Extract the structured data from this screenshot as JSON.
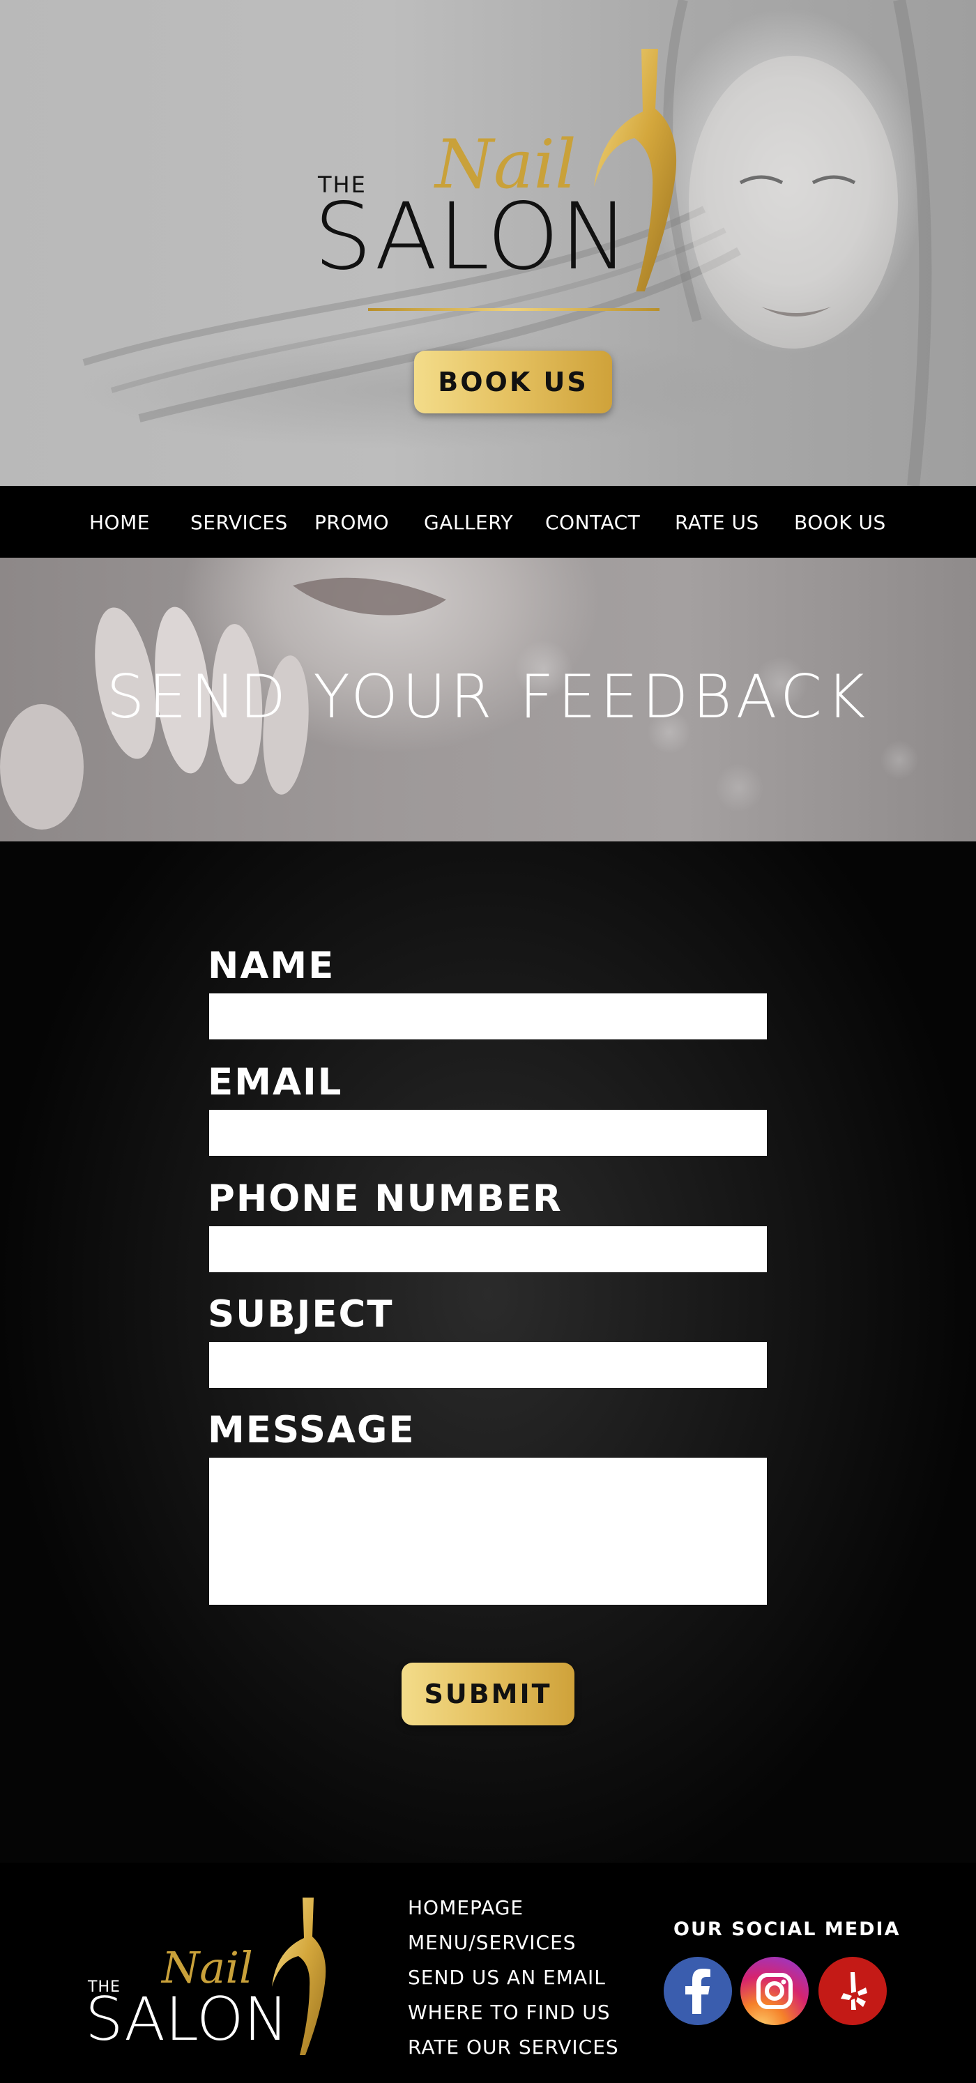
{
  "hero": {
    "logo": {
      "the": "THE",
      "nail": "Nail",
      "salon": "SALON"
    },
    "book_button": "BOOK US"
  },
  "nav": {
    "items": [
      {
        "label": "HOME"
      },
      {
        "label": "SERVICES"
      },
      {
        "label": "PROMO"
      },
      {
        "label": "GALLERY"
      },
      {
        "label": "CONTACT"
      },
      {
        "label": "RATE US"
      },
      {
        "label": "BOOK US"
      }
    ]
  },
  "banner": {
    "title": "SEND YOUR FEEDBACK"
  },
  "form": {
    "fields": [
      {
        "label": "NAME",
        "value": ""
      },
      {
        "label": "EMAIL",
        "value": ""
      },
      {
        "label": "PHONE NUMBER",
        "value": ""
      },
      {
        "label": "SUBJECT",
        "value": ""
      },
      {
        "label": "MESSAGE",
        "value": ""
      }
    ],
    "submit_label": "SUBMIT"
  },
  "footer": {
    "logo": {
      "the": "THE",
      "nail": "Nail",
      "salon": "SALON"
    },
    "links": [
      {
        "label": "HOMEPAGE"
      },
      {
        "label": "MENU/SERVICES"
      },
      {
        "label": "SEND US AN EMAIL"
      },
      {
        "label": "WHERE TO FIND US"
      },
      {
        "label": "RATE OUR SERVICES"
      }
    ],
    "social_title": "OUR SOCIAL MEDIA",
    "social": [
      {
        "icon": "facebook-icon",
        "color": "#3a5dae"
      },
      {
        "icon": "instagram-icon",
        "color": "#d6246e"
      },
      {
        "icon": "yelp-icon",
        "color": "#c41a16"
      }
    ]
  },
  "colors": {
    "gold": "#e6c363",
    "gold_dark": "#c9a13a",
    "black": "#000000"
  }
}
